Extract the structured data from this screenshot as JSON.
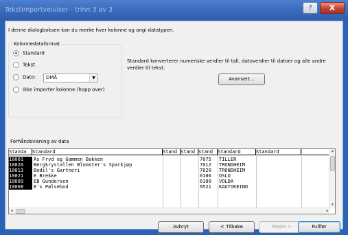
{
  "window": {
    "title": "Tekstimportveiviser - trinn 3 av 3",
    "help_label": "?",
    "close_label": "X"
  },
  "intro": "I denne dialogboksen kan du merke hver kolonne og angi datatypen.",
  "column_format": {
    "legend": "Kolonnedataformat",
    "options": [
      {
        "label": "Standard",
        "checked": true
      },
      {
        "label": "Tekst",
        "checked": false
      },
      {
        "label": "Dato:",
        "checked": false
      },
      {
        "label": "Ikke importer kolonne (hopp over)",
        "checked": false
      }
    ],
    "date_format": "DMÅ",
    "description": "Standard konverterer numeriske verdier til tall, datoverdier til datoer og alle andre verdier til tekst.",
    "advanced_label": "Avansert..."
  },
  "preview": {
    "legend": "Forhåndsvisning av data",
    "headers": [
      "Standa",
      "Standard",
      "Stand",
      "Stand",
      "Stand",
      "Standard",
      "Standard"
    ],
    "rows": [
      [
        "10001",
        "Ås Fryd og Gammen Bakken",
        "",
        "",
        "7075",
        "TILLER",
        ""
      ],
      [
        "10020",
        "Bergkrystallen Blomster's Sparkjøp",
        "",
        "",
        "7012",
        "TRONDHEIM",
        ""
      ],
      [
        "10013",
        "Bodil's Gartneri",
        "",
        "",
        "7020",
        "TRONDHEIM",
        ""
      ],
      [
        "10021",
        "E Brekke",
        "",
        "",
        "0106",
        "OSLO",
        ""
      ],
      [
        "10009",
        "EB Gundersen",
        "",
        "",
        "6100",
        "VOLDA",
        ""
      ],
      [
        "10008",
        "E's Pølsebod",
        "",
        "",
        "9521",
        "KAUTOKEINO",
        ""
      ]
    ]
  },
  "buttons": {
    "cancel": "Avbryt",
    "back": "< Tilbake",
    "next": "Neste >",
    "finish": "Fullfør"
  }
}
